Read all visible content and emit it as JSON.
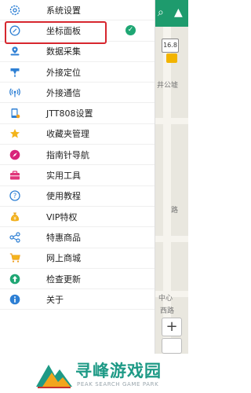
{
  "menu": {
    "items": [
      {
        "label": "系统设置",
        "icon": "gear-icon"
      },
      {
        "label": "坐标面板",
        "icon": "compass-icon",
        "selected": true
      },
      {
        "label": "数据采集",
        "icon": "map-marker-icon"
      },
      {
        "label": "外接定位",
        "icon": "satellite-dish-icon"
      },
      {
        "label": "外接通信",
        "icon": "wireless-icon"
      },
      {
        "label": "JTT808设置",
        "icon": "phone-settings-icon"
      },
      {
        "label": "收藏夹管理",
        "icon": "star-icon"
      },
      {
        "label": "指南针导航",
        "icon": "compass-navigation-icon"
      },
      {
        "label": "实用工具",
        "icon": "toolbox-icon"
      },
      {
        "label": "使用教程",
        "icon": "question-icon"
      },
      {
        "label": "VIP特权",
        "icon": "money-bag-icon"
      },
      {
        "label": "特惠商品",
        "icon": "share-icon"
      },
      {
        "label": "网上商城",
        "icon": "shopping-cart-icon"
      },
      {
        "label": "检查更新",
        "icon": "upload-arrow-icon"
      },
      {
        "label": "关于",
        "icon": "info-icon"
      }
    ]
  },
  "map": {
    "badge": "16.8",
    "labels": {
      "label_a": "井公墟",
      "label_b": "中心",
      "label_c": "路",
      "label_d": "西路"
    },
    "zoom_in": "+"
  },
  "watermark": {
    "title": "寻峰游戏园",
    "subtitle": "PEAK SEARCH GAME PARK"
  },
  "colors": {
    "accent_green": "#1ea673",
    "highlight_red": "#d6262e",
    "icon_blue": "#2d7fd4"
  }
}
